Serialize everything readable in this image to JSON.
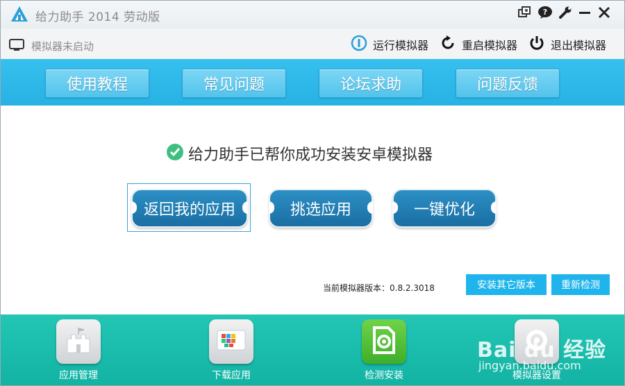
{
  "window": {
    "title": "给力助手 2014 劳动版",
    "icons": [
      "restore-icon",
      "feedback-bubble-icon",
      "wrench-icon",
      "minimize-icon",
      "close-icon"
    ]
  },
  "status": {
    "text": "模拟器未启动",
    "run_label": "运行模拟器",
    "restart_label": "重启模拟器",
    "exit_label": "退出模拟器"
  },
  "nav": {
    "items": [
      "使用教程",
      "常见问题",
      "论坛求助",
      "问题反馈"
    ]
  },
  "main": {
    "success_message": "给力助手已帮你成功安装安卓模拟器",
    "actions": [
      "返回我的应用",
      "挑选应用",
      "一键优化"
    ],
    "version_text": "当前模拟器版本：0.8.2.3018",
    "install_other_label": "安装其它版本",
    "redetect_label": "重新检测"
  },
  "bottom": {
    "tiles": [
      "应用管理",
      "下载应用",
      "检测安装",
      "模拟器设置"
    ]
  },
  "watermark": {
    "big": "Bai du 经验",
    "small": "jingyan.baidu.com"
  },
  "colors": {
    "nav_band": "#36c0ef",
    "action_button": "#1a6ea3",
    "bottom_band": "#13b3a4",
    "success_check": "#3fbf7f"
  }
}
